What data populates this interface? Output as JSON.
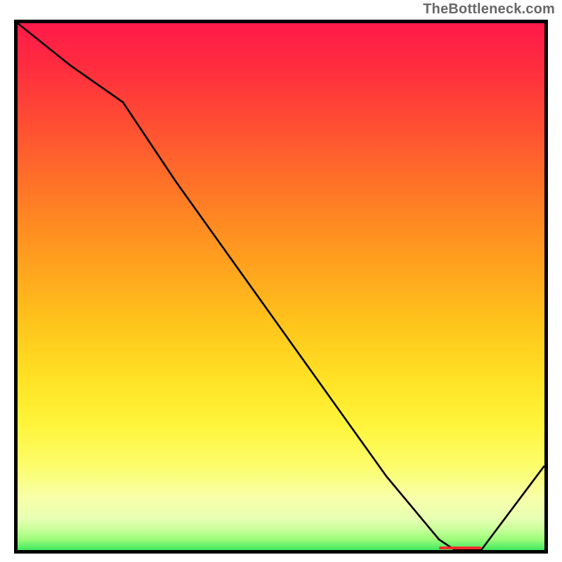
{
  "attribution": "TheBottleneck.com",
  "chart_data": {
    "type": "line",
    "title": "",
    "xlabel": "",
    "ylabel": "",
    "xlim": [
      0,
      100
    ],
    "ylim": [
      0,
      100
    ],
    "grid": false,
    "series": [
      {
        "name": "bottleneck-curve",
        "x": [
          0,
          10,
          20,
          30,
          40,
          50,
          60,
          70,
          80,
          83,
          88,
          100
        ],
        "values": [
          100,
          92,
          85,
          70,
          56,
          42,
          28,
          14,
          2,
          0,
          0,
          16
        ]
      }
    ],
    "annotations": [
      {
        "name": "optimal-range-marker",
        "x_start": 80,
        "x_end": 88,
        "y": 0.5
      }
    ],
    "background": {
      "type": "vertical-gradient",
      "stops": [
        {
          "pos": 0,
          "color": "#ff1a4a"
        },
        {
          "pos": 50,
          "color": "#ffb01c"
        },
        {
          "pos": 80,
          "color": "#fff53a"
        },
        {
          "pos": 100,
          "color": "#3fe85e"
        }
      ]
    }
  }
}
